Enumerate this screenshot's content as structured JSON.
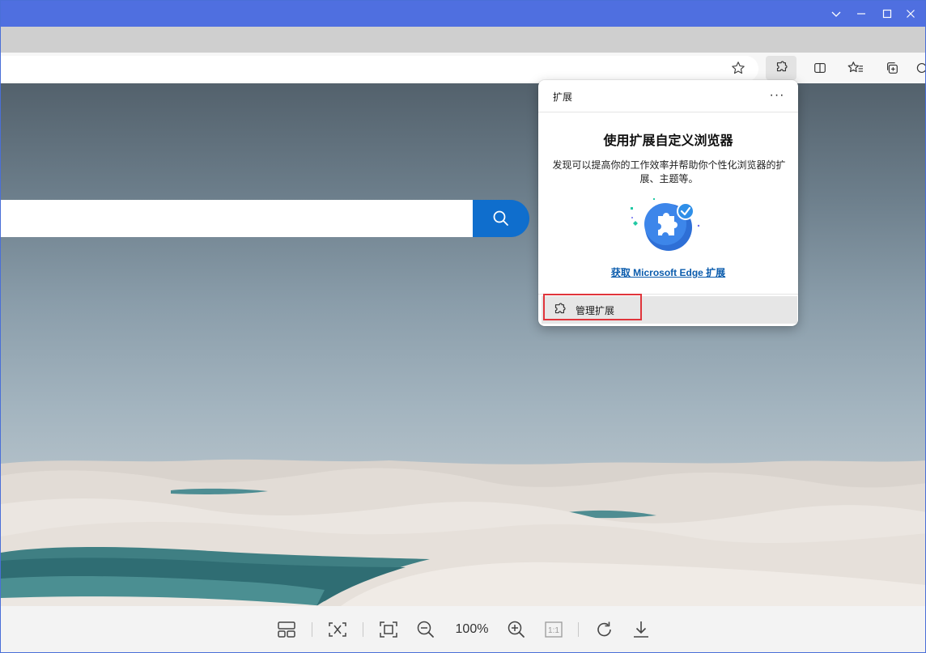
{
  "window": {
    "controls": [
      "chevron-down-icon",
      "minimize-icon",
      "maximize-icon",
      "close-icon"
    ],
    "accent_color": "#4f6fe0"
  },
  "toolbar": {
    "buttons": [
      "favorite-star-icon",
      "extensions-icon",
      "split-screen-icon",
      "favorites-icon",
      "collections-icon",
      "copilot-icon"
    ]
  },
  "search": {
    "placeholder": "",
    "button_color": "#0f6ecd"
  },
  "extensions_flyout": {
    "title": "扩展",
    "more_label": "···",
    "heading": "使用扩展自定义浏览器",
    "description": "发现可以提高你的工作效率并帮助你个性化浏览器的扩展、主题等。",
    "link_label": "获取 Microsoft Edge 扩展",
    "manage_label": "管理扩展",
    "highlight_color": "#e0353b"
  },
  "bottom_toolbar": {
    "zoom_label": "100%",
    "actual_size_label": "1:1",
    "buttons": [
      "layout-icon",
      "fit-icon",
      "fullscreen-icon",
      "zoom-out-icon",
      "zoom-in-icon",
      "actual-size-icon",
      "rotate-icon",
      "download-icon"
    ]
  }
}
